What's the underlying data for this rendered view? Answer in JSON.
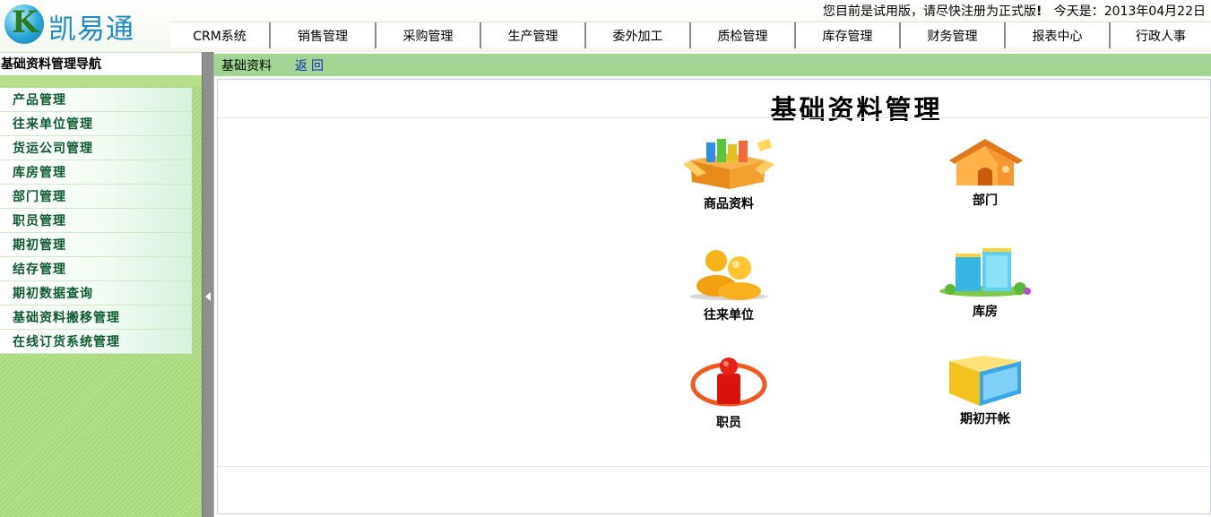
{
  "app": {
    "logo_text": "凯易通",
    "logo_letter": "K"
  },
  "header": {
    "notice": "您目前是试用版，请尽快注册为正式版",
    "notice_mark": "!",
    "today_label": "今天是：2013年04月22日"
  },
  "topnav": [
    {
      "label": "CRM系统"
    },
    {
      "label": "销售管理"
    },
    {
      "label": "采购管理"
    },
    {
      "label": "生产管理"
    },
    {
      "label": "委外加工"
    },
    {
      "label": "质检管理"
    },
    {
      "label": "库存管理"
    },
    {
      "label": "财务管理"
    },
    {
      "label": "报表中心"
    },
    {
      "label": "行政人事"
    }
  ],
  "sidebar": {
    "title": "基础资料管理导航",
    "items": [
      {
        "label": "产品管理"
      },
      {
        "label": "往来单位管理"
      },
      {
        "label": "货运公司管理"
      },
      {
        "label": "库房管理"
      },
      {
        "label": "部门管理"
      },
      {
        "label": "职员管理"
      },
      {
        "label": "期初管理"
      },
      {
        "label": "结存管理"
      },
      {
        "label": "期初数据查询"
      },
      {
        "label": "基础资料搬移管理"
      },
      {
        "label": "在线订货系统管理"
      }
    ]
  },
  "breadcrumb": {
    "current": "基础资料",
    "back_label": "返回"
  },
  "main": {
    "title": "基础资料管理",
    "tiles": [
      {
        "label": "商品资料",
        "icon": "product-box-icon"
      },
      {
        "label": "部门",
        "icon": "house-icon"
      },
      {
        "label": "往来单位",
        "icon": "people-icon"
      },
      {
        "label": "库房",
        "icon": "building-icon"
      },
      {
        "label": "职员",
        "icon": "staff-person-icon"
      },
      {
        "label": "期初开帐",
        "icon": "folder-icon"
      }
    ]
  },
  "colors": {
    "sidebar_green": "#b6e08c",
    "breadcrumb_green": "#a2d493",
    "sidebar_text": "#0d5b32",
    "link_blue": "#0a2ec0"
  }
}
